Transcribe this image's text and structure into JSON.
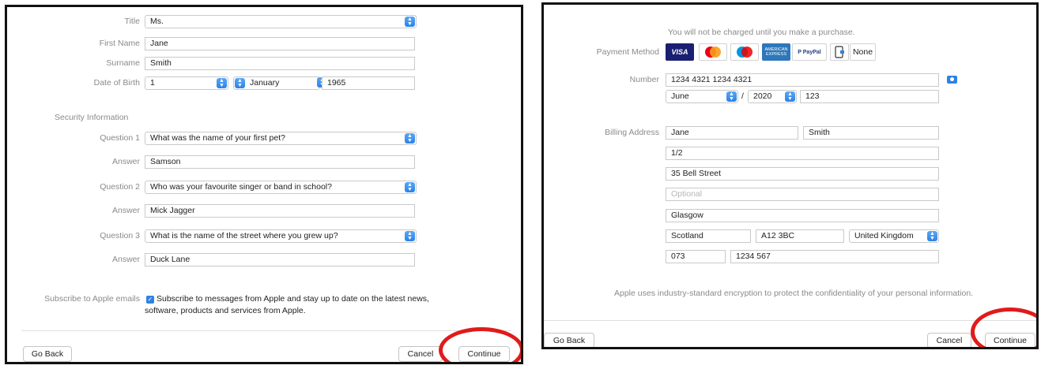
{
  "left": {
    "title_label": "Title",
    "title_value": "Ms.",
    "first_name_label": "First Name",
    "first_name_value": "Jane",
    "surname_label": "Surname",
    "surname_value": "Smith",
    "dob_label": "Date of Birth",
    "dob_day": "1",
    "dob_month": "January",
    "dob_year": "1965",
    "security_heading": "Security Information",
    "q1_label": "Question 1",
    "q1_value": "What was the name of your first pet?",
    "a1_label": "Answer",
    "a1_value": "Samson",
    "q2_label": "Question 2",
    "q2_value": "Who was your favourite singer or band in school?",
    "a2_label": "Answer",
    "a2_value": "Mick Jagger",
    "q3_label": "Question 3",
    "q3_value": "What is the name of the street where you grew up?",
    "a3_label": "Answer",
    "a3_value": "Duck Lane",
    "subscribe_label": "Subscribe to Apple emails",
    "subscribe_text_1": "Subscribe to messages from Apple and stay up to date on the latest news,",
    "subscribe_text_2": "software, products and services from Apple.",
    "go_back": "Go Back",
    "cancel": "Cancel",
    "continue": "Continue"
  },
  "right": {
    "charge_note": "You will not be charged until you make a purchase.",
    "payment_method_label": "Payment Method",
    "payment_methods": [
      "VISA",
      "MasterCard",
      "Maestro",
      "AMERICAN EXPRESS",
      "P PayPal",
      "Apple Pay",
      "None"
    ],
    "number_label": "Number",
    "card_number": "1234 4321 1234 4321",
    "exp_month": "June",
    "exp_sep": "/",
    "exp_year": "2020",
    "cvv": "123",
    "billing_label": "Billing Address",
    "billing_first": "Jane",
    "billing_last": "Smith",
    "address_1": "1/2",
    "address_2": "35 Bell Street",
    "address_3_placeholder": "Optional",
    "city": "Glasgow",
    "region": "Scotland",
    "postcode": "A12 3BC",
    "country": "United Kingdom",
    "phone_area": "073",
    "phone_number": "1234 567",
    "encryption_note": "Apple uses industry-standard encryption to protect the confidentiality of your personal information.",
    "go_back": "Go Back",
    "cancel": "Cancel",
    "continue": "Continue"
  },
  "colors": {
    "accent": "#2d82e6",
    "highlight_ring": "#e01b1b",
    "label_gray": "#8a8a8a"
  },
  "icons": [
    "chevron-updown-icon",
    "camera-icon",
    "checkbox-checked-icon"
  ]
}
